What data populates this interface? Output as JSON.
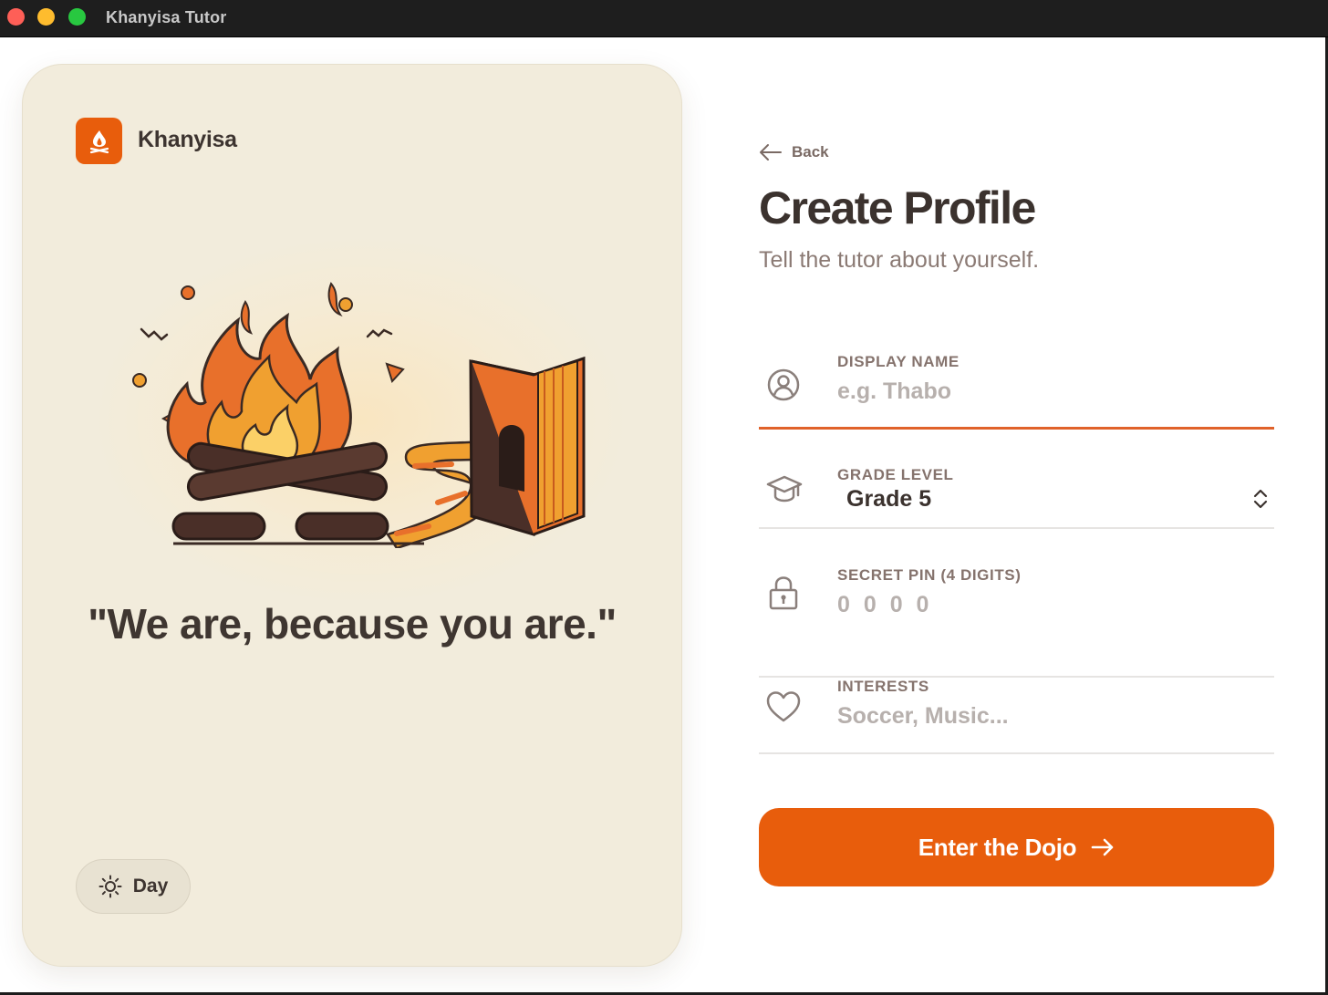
{
  "window": {
    "title": "Khanyisa Tutor"
  },
  "brand": {
    "name": "Khanyisa",
    "accent_color": "#e85d0c",
    "logo_icon": "campfire-icon"
  },
  "hero": {
    "illustration": "campfire-and-book-illustration",
    "quote": "\"We are, because you are.\""
  },
  "theme_toggle": {
    "label": "Day",
    "icon": "sun-icon"
  },
  "form": {
    "back_label": "Back",
    "title": "Create Profile",
    "subtitle": "Tell the tutor about yourself.",
    "fields": {
      "display_name": {
        "label": "DISPLAY NAME",
        "placeholder": "e.g. Thabo",
        "value": "",
        "icon": "user-circle-icon"
      },
      "grade_level": {
        "label": "GRADE LEVEL",
        "value": "Grade 5",
        "icon": "graduation-cap-icon"
      },
      "secret_pin": {
        "label": "SECRET PIN (4 DIGITS)",
        "placeholder": "0 0 0 0",
        "value": "",
        "icon": "lock-icon"
      },
      "interests": {
        "label": "INTERESTS",
        "placeholder": "Soccer, Music...",
        "value": "",
        "icon": "heart-icon"
      }
    },
    "submit_label": "Enter the Dojo",
    "submit_icon": "arrow-right-icon"
  }
}
